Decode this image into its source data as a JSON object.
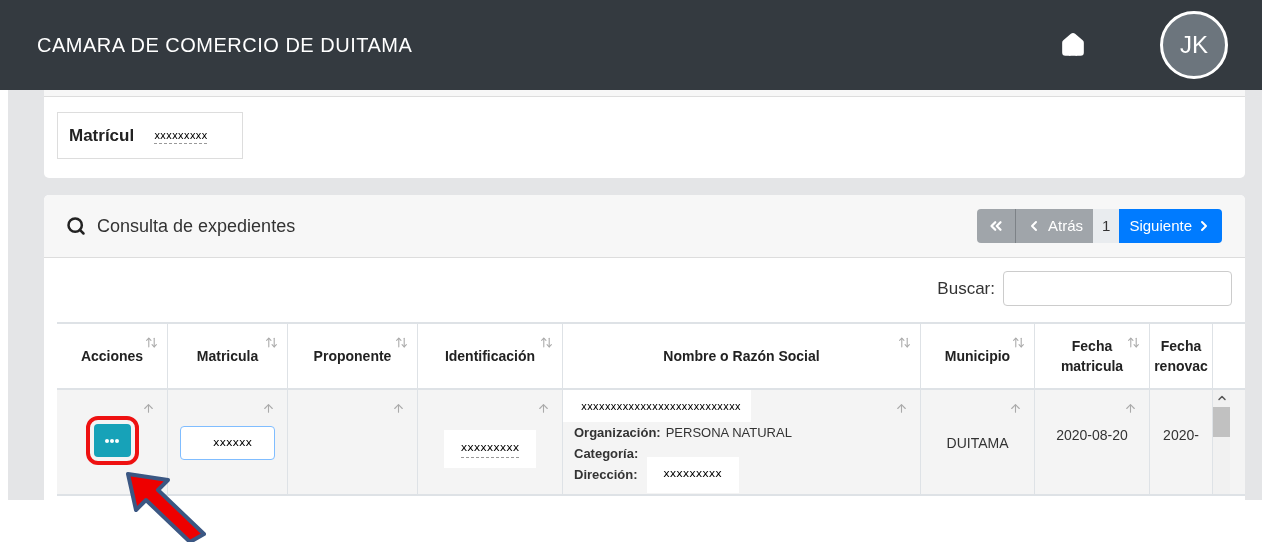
{
  "header": {
    "title": "CAMARA DE COMERCIO DE DUITAMA",
    "avatar": "JK"
  },
  "filter": {
    "label": "Matrícul",
    "value": "xxxxxxxxx"
  },
  "panel": {
    "title": "Consulta de expedientes",
    "search_label": "Buscar:",
    "pagination": [
      {
        "kind": "first",
        "disabled": true
      },
      {
        "kind": "prev",
        "label": "Atrás",
        "disabled": true
      },
      {
        "kind": "page",
        "label": "1"
      },
      {
        "kind": "next",
        "label": "Siguiente",
        "disabled": false
      }
    ]
  },
  "table": {
    "columns": [
      {
        "label": "Acciones"
      },
      {
        "label": "Matricula"
      },
      {
        "label": "Proponente"
      },
      {
        "label": "Identificación"
      },
      {
        "label": "Nombre o Razón Social"
      },
      {
        "label": "Municipio"
      },
      {
        "label": "Fecha matricula"
      },
      {
        "label": "Fecha renovac"
      }
    ],
    "rows": [
      {
        "highlighted": true,
        "cells": [
          {
            "kind": "action"
          },
          {
            "kind": "redacted-input",
            "value": "xxxxxx"
          },
          {
            "kind": "empty"
          },
          {
            "kind": "redacted",
            "value": "xxxxxxxxx"
          },
          {
            "kind": "details",
            "value": "xxxxxxxxxxxxxxxxxxxxxxxxxxx",
            "fields": [
              {
                "label": "Organización:",
                "value": "PERSONA NATURAL"
              },
              {
                "label": "Categoría:"
              },
              {
                "label": "Dirección:",
                "redacted": "xxxxxxxxx"
              }
            ]
          },
          {
            "kind": "middle-text",
            "value": "DUITAMA"
          },
          {
            "kind": "text",
            "value": "2020-08-20"
          },
          {
            "kind": "text",
            "value": "2020-"
          }
        ]
      }
    ]
  }
}
